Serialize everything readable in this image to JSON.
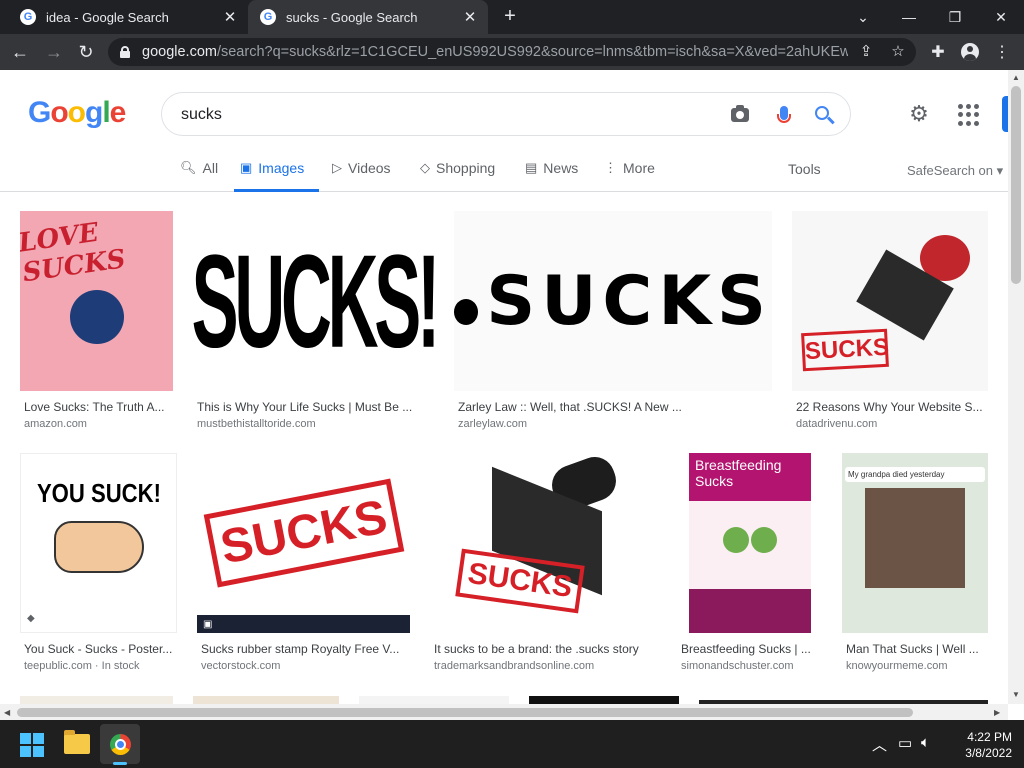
{
  "browser": {
    "tabs": [
      {
        "title": "idea - Google Search",
        "active": false
      },
      {
        "title": "sucks - Google Search",
        "active": true
      }
    ],
    "url_host": "google.com",
    "url_rest": "/search?q=sucks&rlz=1C1GCEU_enUS992US992&source=lnms&tbm=isch&sa=X&ved=2ahUKEwi3n..."
  },
  "search": {
    "query": "sucks",
    "tabs": [
      {
        "label": "All",
        "icon": "search-icon"
      },
      {
        "label": "Images",
        "icon": "image-icon"
      },
      {
        "label": "Videos",
        "icon": "play-icon"
      },
      {
        "label": "Shopping",
        "icon": "tag-icon"
      },
      {
        "label": "News",
        "icon": "news-icon"
      },
      {
        "label": "More",
        "icon": "more-vert-icon"
      }
    ],
    "tools_label": "Tools",
    "safesearch_label": "SafeSearch on"
  },
  "results": [
    {
      "title": "Love Sucks: The Truth A...",
      "source": "amazon.com",
      "thumb_text": "LOVE SUCKS"
    },
    {
      "title": "This is Why Your Life Sucks | Must Be ...",
      "source": "mustbethistalltoride.com",
      "thumb_text": "SUCKS!"
    },
    {
      "title": "Zarley Law :: Well, that .SUCKS! A New ...",
      "source": "zarleylaw.com",
      "thumb_text": "SUCKS"
    },
    {
      "title": "22 Reasons Why Your Website S...",
      "source": "datadrivenu.com",
      "thumb_text": "SUCKS"
    },
    {
      "title": "You Suck - Sucks - Poster...",
      "source": "teepublic.com · In stock",
      "thumb_text": "YOU SUCK!"
    },
    {
      "title": "Sucks rubber stamp Royalty Free V...",
      "source": "vectorstock.com",
      "thumb_text": "SUCKS"
    },
    {
      "title": "It sucks to be a brand: the .sucks story",
      "source": "trademarksandbrandsonline.com",
      "thumb_text": "SUCKS"
    },
    {
      "title": "Breastfeeding Sucks | ...",
      "source": "simonandschuster.com",
      "thumb_text": "Breastfeeding Sucks"
    },
    {
      "title": "Man That Sucks | Well ...",
      "source": "knowyourmeme.com",
      "thumb_text": "My grandpa died yesterday"
    }
  ],
  "taskbar": {
    "time": "4:22 PM",
    "date": "3/8/2022"
  },
  "colors": {
    "google_blue": "#1a73e8",
    "stamp_red": "#d62027",
    "chrome_dark": "#202124"
  }
}
